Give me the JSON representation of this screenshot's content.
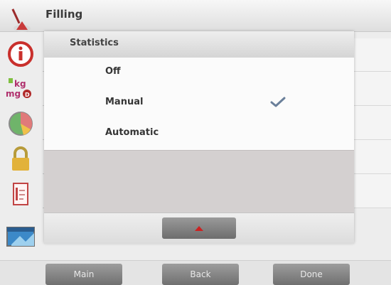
{
  "header": {
    "title": "Filling"
  },
  "dialog": {
    "title": "Statistics",
    "options": [
      {
        "label": "Off",
        "selected": false
      },
      {
        "label": "Manual",
        "selected": true
      },
      {
        "label": "Automatic",
        "selected": false
      }
    ],
    "scroll_up_icon": "arrow-up-icon"
  },
  "sidebar": {
    "icons": [
      "filling-icon",
      "info-icon",
      "units-icon",
      "chart-icon",
      "lock-icon",
      "print-icon",
      "display-icon"
    ]
  },
  "bottom": {
    "main_label": "Main",
    "back_label": "Back",
    "done_label": "Done"
  },
  "colors": {
    "accent_red": "#cc2222",
    "check_blue": "#6a7f9a",
    "button_gray": "#808080"
  }
}
